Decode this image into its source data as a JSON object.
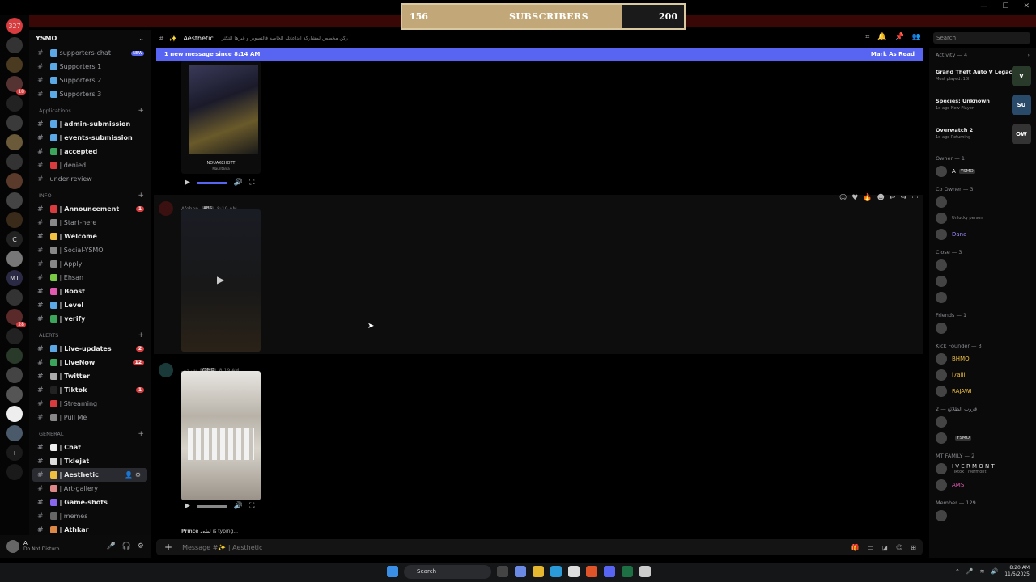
{
  "subscriber_goal": {
    "current": "156",
    "label": "SUBSCRIBERS",
    "goal": "200",
    "progress_fraction": 0.78
  },
  "server": {
    "name": "YSMO"
  },
  "rail": [
    {
      "label": "327",
      "color": "#d83c3e"
    },
    {
      "label": "",
      "color": "#333"
    },
    {
      "label": "",
      "color": "#4a3a20"
    },
    {
      "label": "",
      "color": "#553333",
      "badge": "18"
    },
    {
      "label": "",
      "color": "#222"
    },
    {
      "label": "",
      "color": "#3a3a3a"
    },
    {
      "label": "",
      "color": "#6a5a3a"
    },
    {
      "label": "",
      "color": "#333"
    },
    {
      "label": "",
      "color": "#5a3a2a"
    },
    {
      "label": "",
      "color": "#444"
    },
    {
      "label": "",
      "color": "#3a2a1a"
    },
    {
      "label": "C",
      "color": "#222"
    },
    {
      "label": "",
      "color": "#777"
    },
    {
      "label": "MT",
      "color": "#2a2a44"
    },
    {
      "label": "",
      "color": "#333"
    },
    {
      "label": "",
      "color": "#5a2a2a",
      "badge": "28"
    },
    {
      "label": "",
      "color": "#222"
    },
    {
      "label": "",
      "color": "#2a3a2a"
    },
    {
      "label": "",
      "color": "#444"
    },
    {
      "label": "",
      "color": "#555"
    },
    {
      "label": "",
      "color": "#eee"
    },
    {
      "label": "",
      "color": "#4a5a6a"
    },
    {
      "label": "+",
      "color": "#1a1a1a"
    },
    {
      "label": "",
      "color": "#1a1a1a"
    }
  ],
  "channels": [
    {
      "type": "ch",
      "label": "supporters-chat",
      "color": "#5aa9e6",
      "new": "NEW"
    },
    {
      "type": "ch",
      "label": "Supporters 1",
      "color": "#5aa9e6"
    },
    {
      "type": "ch",
      "label": "Supporters 2",
      "color": "#5aa9e6"
    },
    {
      "type": "ch",
      "label": "Supporters 3",
      "color": "#5aa9e6"
    },
    {
      "type": "cat",
      "label": "Applications"
    },
    {
      "type": "ch",
      "label": "| admin-submission",
      "color": "#5aa9e6",
      "bold": true
    },
    {
      "type": "ch",
      "label": "| events-submission",
      "color": "#5aa9e6",
      "bold": true
    },
    {
      "type": "ch",
      "label": "| accepted",
      "color": "#3ba55c",
      "bold": true
    },
    {
      "type": "ch",
      "label": "| denied",
      "color": "#d83c3e"
    },
    {
      "type": "ch",
      "label": "under-review",
      "color": ""
    },
    {
      "type": "cat",
      "label": "INFO"
    },
    {
      "type": "ch",
      "label": "| Announcement",
      "color": "#d83c3e",
      "bold": true,
      "count": "1"
    },
    {
      "type": "ch",
      "label": "| Start-here",
      "color": "#888"
    },
    {
      "type": "ch",
      "label": "| Welcome",
      "color": "#f0c040",
      "bold": true
    },
    {
      "type": "ch",
      "label": "| Social-YSMO",
      "color": "#888"
    },
    {
      "type": "ch",
      "label": "| Apply",
      "color": "#888"
    },
    {
      "type": "ch",
      "label": "| Ehsan",
      "color": "#7ac943"
    },
    {
      "type": "ch",
      "label": "| Boost",
      "color": "#e05ab0",
      "bold": true
    },
    {
      "type": "ch",
      "label": "| Level",
      "color": "#5aa9e6",
      "bold": true
    },
    {
      "type": "ch",
      "label": "| verify",
      "color": "#3ba55c",
      "bold": true
    },
    {
      "type": "cat",
      "label": "ALERTS"
    },
    {
      "type": "ch",
      "label": "| Live-updates",
      "color": "#5aa9e6",
      "bold": true,
      "count": "2"
    },
    {
      "type": "ch",
      "label": "| LiveNow",
      "color": "#3ba55c",
      "bold": true,
      "count": "12"
    },
    {
      "type": "ch",
      "label": "| Twitter",
      "color": "#aaa",
      "bold": true
    },
    {
      "type": "ch",
      "label": "| Tiktok",
      "color": "#222",
      "bold": true,
      "count": "1"
    },
    {
      "type": "ch",
      "label": "| Streaming",
      "color": "#d83c3e"
    },
    {
      "type": "ch",
      "label": "| Pull Me",
      "color": "#888"
    },
    {
      "type": "cat",
      "label": "GENERAL"
    },
    {
      "type": "ch",
      "label": "| Chat",
      "color": "#eee",
      "bold": true
    },
    {
      "type": "ch",
      "label": "| Tklejat",
      "color": "#ddd",
      "bold": true
    },
    {
      "type": "ch",
      "label": "| Aesthetic",
      "color": "#f0c040",
      "bold": true,
      "active": true
    },
    {
      "type": "ch",
      "label": "| Art-gallery",
      "color": "#d88"
    },
    {
      "type": "ch",
      "label": "| Game-shots",
      "color": "#8866ee",
      "bold": true
    },
    {
      "type": "ch",
      "label": "| memes",
      "color": "#666"
    },
    {
      "type": "ch",
      "label": "| Athkar",
      "color": "#d84",
      "bold": true
    }
  ],
  "user": {
    "name": "A",
    "status": "Do Not Disturb"
  },
  "chat": {
    "channel": "✨ | Aesthetic",
    "topic": "ركن مخصص لمشاركة ابداعاتك الخاصه فالتصوير و غيرها التكثر",
    "new_message_text": "1 new message since 8:14 AM",
    "mark_as_read": "Mark As Read",
    "video1_caption_title": "NOUAKCHOTT",
    "video1_caption_sub": "Mauritania",
    "msg2": {
      "author": "Afghan",
      "tag": "ABS",
      "time": "8:19 AM"
    },
    "msg3": {
      "author": "شرحبي",
      "tag": "YSMO",
      "time": "8:19 AM"
    },
    "typing_name": "Prince ليلى",
    "typing_text": "is typing...",
    "input_placeholder": "Message #✨ | Aesthetic",
    "search_placeholder": "Search"
  },
  "members": {
    "activity_header": "Activity — 4",
    "activities": [
      {
        "name": "Grand Theft Auto V Legacy",
        "sub": "Most played: 10h",
        "icon": "V",
        "color": "#2a3a2a"
      },
      {
        "name": "Species: Unknown",
        "sub": "1d ago  New Player",
        "icon": "SU",
        "color": "#2a4a6a"
      },
      {
        "name": "Overwatch 2",
        "sub": "1d ago  Returning",
        "icon": "OW",
        "color": "#333"
      }
    ],
    "groups": [
      {
        "title": "Owner — 1",
        "members": [
          {
            "name": "A",
            "tag": "YSMO",
            "color": "#eee"
          }
        ]
      },
      {
        "title": "Co Owner — 3",
        "members": [
          {
            "name": "",
            "color": "#b070e0"
          },
          {
            "name": "",
            "color": "#a44",
            "sub": "Unlucky person"
          },
          {
            "name": "Dana",
            "color": "#9a8cff"
          }
        ]
      },
      {
        "title": "Close — 3",
        "members": [
          {
            "name": "",
            "color": "#aaa"
          },
          {
            "name": "",
            "color": "#a44"
          },
          {
            "name": "",
            "color": "#a44"
          }
        ]
      },
      {
        "title": "Friends — 1",
        "members": [
          {
            "name": "",
            "color": "#5aa9e6"
          }
        ]
      },
      {
        "title": "Kick Founder — 3",
        "members": [
          {
            "name": "BHMO",
            "color": "#f0c040"
          },
          {
            "name": "i7aliii",
            "color": "#f0c040"
          },
          {
            "name": "RAJAWI",
            "color": "#f0c040"
          }
        ]
      },
      {
        "title": "قروب الطلائع — 2",
        "members": [
          {
            "name": "",
            "color": "#d88"
          },
          {
            "name": "",
            "tag": "YSMO",
            "color": "#d88"
          }
        ]
      },
      {
        "title": "MT FAMILY — 2",
        "members": [
          {
            "name": "I V E R M O N T",
            "color": "#ddd",
            "sub": "Tiktok : ivermont_"
          },
          {
            "name": "AMS",
            "color": "#e05ab0"
          }
        ]
      },
      {
        "title": "Member — 129",
        "members": [
          {
            "name": "",
            "color": "#a44"
          }
        ]
      }
    ]
  },
  "taskbar": {
    "search": "Search",
    "time": "8:20 AM",
    "date": "11/6/2025"
  }
}
